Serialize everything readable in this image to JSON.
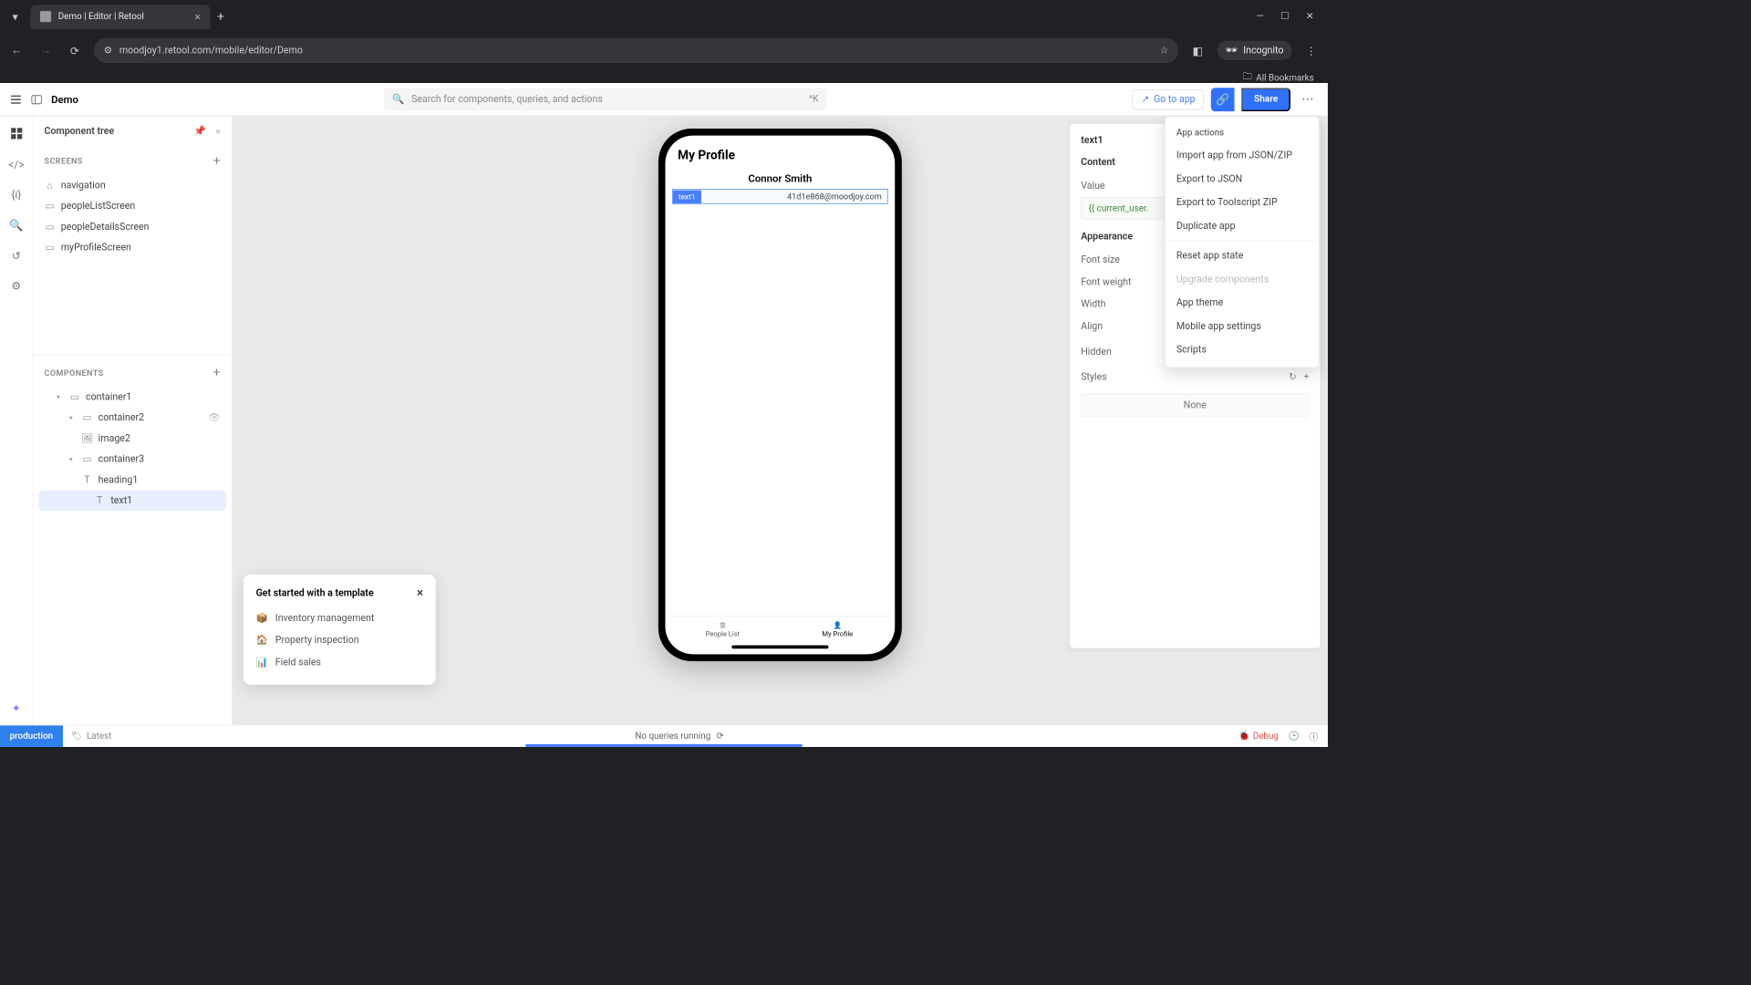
{
  "browser": {
    "tab_title": "Demo | Editor | Retool",
    "url": "moodjoy1.retool.com/mobile/editor/Demo",
    "incognito_label": "Incognito",
    "bookmarks_label": "All Bookmarks"
  },
  "header": {
    "app_title": "Demo",
    "search_placeholder": "Search for components, queries, and actions",
    "search_kbd": "^K",
    "goto_app": "Go to app",
    "share": "Share"
  },
  "left_panel": {
    "title": "Component tree",
    "screens_label": "SCREENS",
    "components_label": "COMPONENTS",
    "screens": [
      {
        "label": "navigation",
        "icon": "home"
      },
      {
        "label": "peopleListScreen",
        "icon": "screen"
      },
      {
        "label": "peopleDetailsScreen",
        "icon": "screen"
      },
      {
        "label": "myProfileScreen",
        "icon": "screen"
      }
    ],
    "components": [
      {
        "label": "container1",
        "indent": 1,
        "toggle": true,
        "icon": "container"
      },
      {
        "label": "container2",
        "indent": 2,
        "toggle": true,
        "icon": "container",
        "hidden_toggle": true
      },
      {
        "label": "image2",
        "indent": 3,
        "icon": "image"
      },
      {
        "label": "container3",
        "indent": 2,
        "toggle": true,
        "icon": "container"
      },
      {
        "label": "heading1",
        "indent": 3,
        "icon": "text"
      },
      {
        "label": "text1",
        "indent": 3,
        "icon": "text",
        "selected": true
      }
    ]
  },
  "phone": {
    "title": "My Profile",
    "user_name": "Connor Smith",
    "selected_label": "text1",
    "selected_value": "41d1e868@moodjoy.com",
    "nav": [
      {
        "label": "People List"
      },
      {
        "label": "My Profile"
      }
    ]
  },
  "right_panel": {
    "title": "text1",
    "content_label": "Content",
    "value_label": "Value",
    "value_code": "{{ current_user.",
    "appearance_label": "Appearance",
    "rows": [
      {
        "label": "Font size"
      },
      {
        "label": "Font weight"
      },
      {
        "label": "Width"
      },
      {
        "label": "Align"
      }
    ],
    "hidden_label": "Hidden",
    "hidden_value": "false",
    "styles_label": "Styles",
    "styles_none": "None"
  },
  "dropdown": {
    "title": "App actions",
    "items": [
      {
        "label": "Import app from JSON/ZIP"
      },
      {
        "label": "Export to JSON"
      },
      {
        "label": "Export to Toolscript ZIP"
      },
      {
        "label": "Duplicate app"
      },
      {
        "sep": true
      },
      {
        "label": "Reset app state"
      },
      {
        "label": "Upgrade components",
        "disabled": true
      },
      {
        "label": "App theme"
      },
      {
        "label": "Mobile app settings"
      },
      {
        "label": "Scripts"
      }
    ]
  },
  "template_card": {
    "title": "Get started with a template",
    "items": [
      "Inventory management",
      "Property inspection",
      "Field sales"
    ]
  },
  "status": {
    "env": "production",
    "latest": "Latest",
    "center": "No queries running",
    "debug": "Debug"
  }
}
